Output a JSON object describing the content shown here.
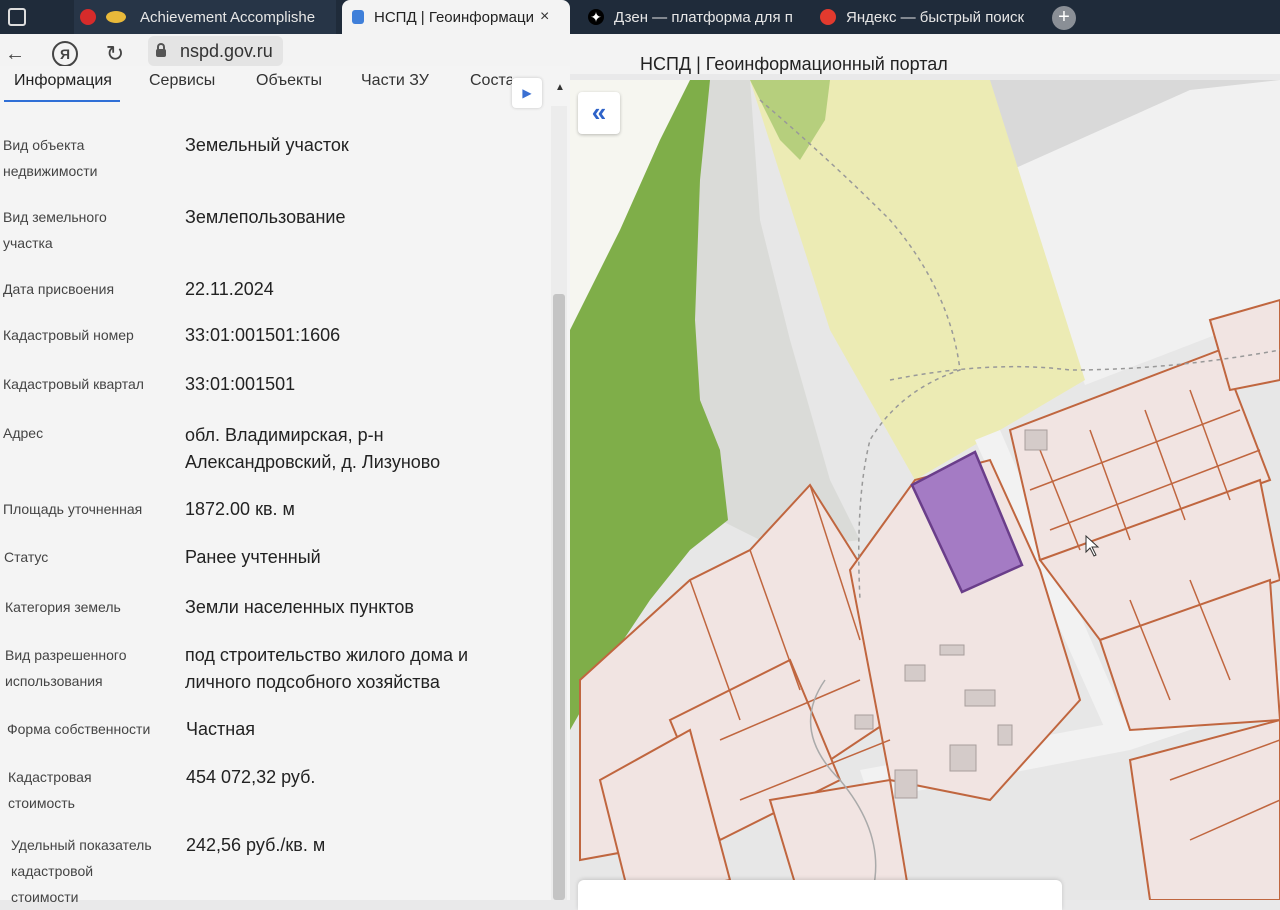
{
  "browser": {
    "tabs": [
      {
        "title": "Achievement Accomplishe"
      },
      {
        "title": "НСПД | Геоинформаци"
      },
      {
        "title": "Дзен — платформа для п"
      },
      {
        "title": "Яндекс — быстрый поиск"
      }
    ],
    "close_glyph": "×",
    "new_tab_glyph": "+",
    "url": "nspd.gov.ru",
    "page_title": "НСПД | Геоинформационный портал",
    "back_glyph": "←",
    "yandex_glyph": "Я",
    "reload_glyph": "↻"
  },
  "panel": {
    "tabs": [
      {
        "label": "Информация"
      },
      {
        "label": "Сервисы"
      },
      {
        "label": "Объекты"
      },
      {
        "label": "Части ЗУ"
      },
      {
        "label": "Соста"
      }
    ],
    "fields": [
      {
        "label": "Вид объекта недвижимости",
        "value": "Земельный участок"
      },
      {
        "label": "Вид земельного участка",
        "value": "Землепользование"
      },
      {
        "label": "Дата присвоения",
        "value": "22.11.2024"
      },
      {
        "label": "Кадастровый номер",
        "value": "33:01:001501:1606"
      },
      {
        "label": "Кадастровый квартал",
        "value": "33:01:001501"
      },
      {
        "label": "Адрес",
        "value": "обл. Владимирская, р-н Александровский, д. Лизуново"
      },
      {
        "label": "Площадь уточненная",
        "value": "1872.00 кв. м"
      },
      {
        "label": "Статус",
        "value": "Ранее учтенный"
      },
      {
        "label": "Категория земель",
        "value": "Земли населенных пунктов"
      },
      {
        "label": "Вид разрешенного использования",
        "value": "под строительство жилого дома и личного подсобного хозяйства"
      },
      {
        "label": "Форма собственности",
        "value": "Частная"
      },
      {
        "label": "Кадастровая стоимость",
        "value": "454 072,32 руб."
      },
      {
        "label": "Удельный показатель кадастровой стоимости",
        "value": "242,56 руб./кв. м"
      }
    ]
  },
  "map": {
    "collapse_glyph": "«",
    "colors": {
      "background": "#e6e6e6",
      "forest": "#7fae49",
      "field": "#ecebb4",
      "parcel_fill": "#f1e4e2",
      "parcel_border": "#c0663f",
      "selected_parcel": "#a47bc4",
      "road": "#f0f0f0"
    }
  },
  "icons": [
    "search-icon",
    "lock-icon",
    "back-arrow-icon",
    "reload-icon",
    "chevron-right-icon",
    "collapse-double-chevron-icon"
  ]
}
